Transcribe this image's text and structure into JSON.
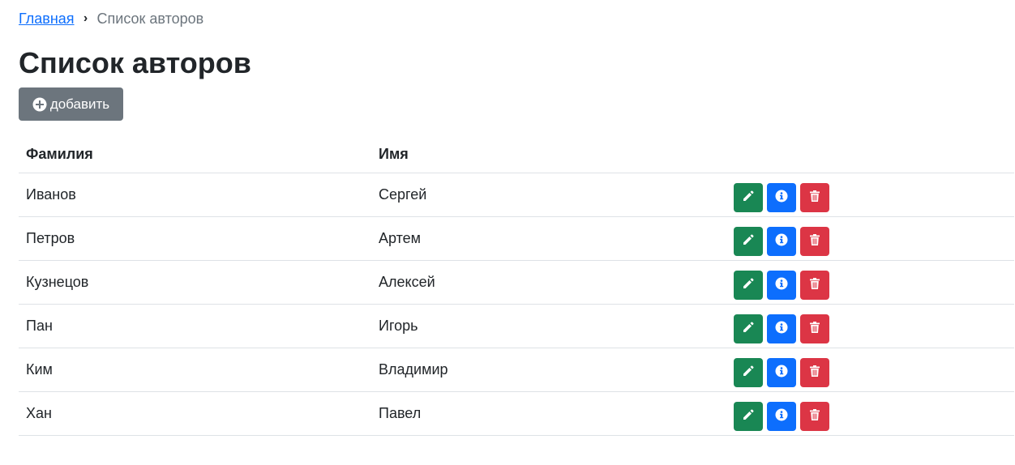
{
  "breadcrumb": {
    "home_label": "Главная",
    "separator": "›",
    "current_label": "Список авторов"
  },
  "page": {
    "title": "Список авторов"
  },
  "toolbar": {
    "add_label": "добавить",
    "add_icon": "plus-circle-icon"
  },
  "table": {
    "headers": [
      "Фамилия",
      "Имя",
      ""
    ],
    "rows": [
      {
        "last_name": "Иванов",
        "first_name": "Сергей"
      },
      {
        "last_name": "Петров",
        "first_name": "Артем"
      },
      {
        "last_name": "Кузнецов",
        "first_name": "Алексей"
      },
      {
        "last_name": "Пан",
        "first_name": "Игорь"
      },
      {
        "last_name": "Ким",
        "first_name": "Владимир"
      },
      {
        "last_name": "Хан",
        "first_name": "Павел"
      }
    ],
    "row_actions": [
      {
        "name": "edit",
        "icon": "pencil-icon",
        "color": "#198754"
      },
      {
        "name": "info",
        "icon": "info-circle-icon",
        "color": "#0d6efd"
      },
      {
        "name": "delete",
        "icon": "trash-icon",
        "color": "#dc3545"
      }
    ]
  },
  "colors": {
    "link": "#0d6efd",
    "muted": "#6c757d",
    "text": "#212529",
    "border": "#dee2e6"
  }
}
